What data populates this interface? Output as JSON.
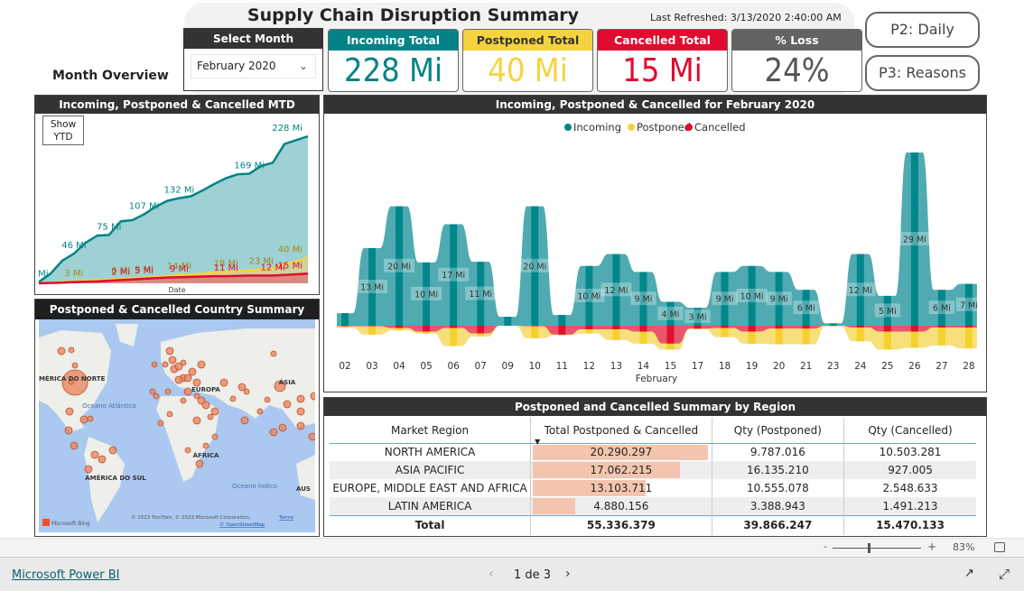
{
  "header": {
    "title": "Supply Chain Disruption Summary",
    "last_refreshed": "Last Refreshed: 3/13/2020 2:40:00 AM",
    "month_overview": "Month Overview"
  },
  "select_month": {
    "label": "Select Month",
    "value": "February 2020",
    "icon": "chevron-down-icon"
  },
  "kpis": [
    {
      "label": "Incoming Total",
      "value": "228 Mi",
      "color": "#038387",
      "text_color": "#038387"
    },
    {
      "label": "Postponed Total",
      "value": "40 Mi",
      "color": "#f5d33f",
      "text_color": "#f5d33f"
    },
    {
      "label": "Cancelled Total",
      "value": "15 Mi",
      "color": "#e00b2f",
      "text_color": "#e00b2f"
    },
    {
      "label": "% Loss",
      "value": "24%",
      "color": "#636363",
      "text_color": "#555555"
    }
  ],
  "nav": {
    "p2": "P2: Daily",
    "p3": "P3: Reasons"
  },
  "mtd": {
    "title": "Incoming, Postponed & Cancelled MTD",
    "show_ytd": "Show YTD",
    "xlabel": "Date"
  },
  "map": {
    "title": "Postponed & Cancelled Country Summary",
    "labels": [
      "MÉRICA DO NORTE",
      "Oceano Atlântico",
      "EUROPA",
      "ÁSIA",
      "ÁFRICA",
      "AMÉRICA DO SUL",
      "Oceano Índico",
      "AUS"
    ],
    "attribution": "© 2023 TomTom, © 2023 Microsoft Corporation,",
    "terms": "Terms",
    "osm": "© OpenStreetMap",
    "bing": "Microsoft Bing"
  },
  "main_chart": {
    "title": "Incoming, Postponed & Cancelled for February 2020",
    "xlabel": "February"
  },
  "chart_data": [
    {
      "type": "area",
      "title": "Incoming, Postponed & Cancelled MTD",
      "xlabel": "Date",
      "series": [
        {
          "name": "Incoming",
          "color": "#038387",
          "values": [
            2,
            15,
            35,
            46,
            63,
            74,
            75,
            96,
            98,
            107,
            119,
            128,
            132,
            135,
            144,
            154,
            163,
            169,
            170,
            182,
            187,
            216,
            222,
            228
          ],
          "labels": {
            "0": "2 Mi",
            "3": "46 Mi",
            "6": "75 Mi",
            "9": "107 Mi",
            "12": "132 Mi",
            "18": "169 Mi",
            "23": "228 Mi"
          }
        },
        {
          "name": "Postponed",
          "color": "#f5d33f",
          "values": [
            0,
            1,
            2,
            3,
            4,
            5,
            6,
            7,
            8,
            9,
            10,
            11,
            14,
            14,
            15,
            17,
            18,
            19,
            20,
            22,
            23,
            30,
            34,
            40
          ],
          "labels": {
            "3": "3 Mi",
            "7": "6 Mi",
            "9": "9 Mi",
            "12": "14 Mi",
            "16": "18 Mi",
            "19": "23 Mi",
            "23": "40 Mi"
          }
        },
        {
          "name": "Cancelled",
          "color": "#e00b2f",
          "values": [
            0,
            0.5,
            1,
            2,
            2.5,
            3,
            4,
            5,
            6,
            7,
            8,
            9,
            9.5,
            10,
            10.5,
            11,
            11,
            11.5,
            12,
            12,
            12,
            13,
            14,
            15
          ],
          "labels": {
            "7": "2 Mi",
            "9": "5 Mi",
            "12": "9 Mi",
            "16": "11 Mi",
            "20": "12 Mi",
            "23": "15 Mi"
          }
        }
      ]
    },
    {
      "type": "area",
      "title": "Incoming, Postponed & Cancelled for February 2020",
      "xlabel": "February",
      "unit": "Mi",
      "legend": [
        "Incoming",
        "Postponed",
        "Cancelled"
      ],
      "legend_position": "top-center",
      "categories": [
        "02",
        "03",
        "04",
        "05",
        "06",
        "07",
        "09",
        "10",
        "11",
        "12",
        "13",
        "14",
        "15",
        "17",
        "18",
        "19",
        "20",
        "21",
        "23",
        "24",
        "25",
        "26",
        "27",
        "28"
      ],
      "series": [
        {
          "name": "Incoming",
          "color": "#038387",
          "values": [
            2.1,
            13,
            20,
            10.6,
            17,
            10.7,
            1.5,
            20,
            1.8,
            10,
            12,
            9,
            4,
            3,
            9,
            10,
            9,
            6,
            0.4,
            12,
            5,
            29,
            6,
            7
          ],
          "labels": [
            null,
            "13 Mi",
            "20 Mi",
            "10 Mi",
            "17 Mi",
            "11 Mi",
            null,
            "20 Mi",
            null,
            "10 Mi",
            "12 Mi",
            "9 Mi",
            "4 Mi",
            "3 Mi",
            "9 Mi",
            "10 Mi",
            "9 Mi",
            "6 Mi",
            null,
            "12 Mi",
            "5 Mi",
            "29 Mi",
            "6 Mi",
            "7 Mi"
          ]
        },
        {
          "name": "Postponed",
          "color": "#f5d33f",
          "values": [
            0.2,
            1.4,
            0.4,
            0.3,
            3,
            0.5,
            0,
            2,
            0.1,
            0.7,
            1.8,
            2,
            1,
            0.1,
            1.5,
            2,
            2.6,
            2.6,
            0.1,
            2.3,
            3,
            2.7,
            3,
            3.5
          ]
        },
        {
          "name": "Cancelled",
          "color": "#e00b2f",
          "values": [
            0.1,
            0.1,
            0.4,
            1,
            0.4,
            1.3,
            0,
            0.1,
            1.5,
            0.6,
            0.6,
            1,
            3,
            0.5,
            0.4,
            1,
            0.5,
            0.5,
            0,
            0.3,
            1,
            1,
            0.3,
            0.3
          ]
        }
      ]
    }
  ],
  "region_table": {
    "title": "Postponed and Cancelled Summary by Region",
    "columns": [
      "Market Region",
      "Total Postponed & Cancelled",
      "Qty (Postponed)",
      "Qty (Cancelled)"
    ],
    "rows": [
      {
        "region": "NORTH AMERICA",
        "total": "20.290.297",
        "total_value": 20290297,
        "postponed": "9.787.016",
        "cancelled": "10.503.281"
      },
      {
        "region": "ASIA PACIFIC",
        "total": "17.062.215",
        "total_value": 17062215,
        "postponed": "16.135.210",
        "cancelled": "927.005"
      },
      {
        "region": "EUROPE, MIDDLE EAST AND AFRICA",
        "total": "13.103.711",
        "total_value": 13103711,
        "postponed": "10.555.078",
        "cancelled": "2.548.633"
      },
      {
        "region": "LATIN AMERICA",
        "total": "4.880.156",
        "total_value": 4880156,
        "postponed": "3.388.943",
        "cancelled": "1.491.213"
      }
    ],
    "total": {
      "label": "Total",
      "total": "55.336.379",
      "postponed": "39.866.247",
      "cancelled": "15.470.133"
    }
  },
  "zoom": {
    "minus": "-",
    "plus": "+",
    "level": "83%",
    "level_value": 83
  },
  "footer": {
    "brand": "Microsoft Power BI",
    "page": "1 de 3"
  }
}
